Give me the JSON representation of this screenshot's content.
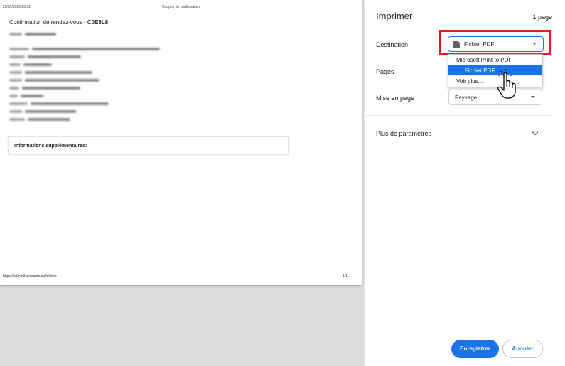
{
  "preview": {
    "header_datetime": "23/01/2026 13:32",
    "header_title": "Coupon de confirmation",
    "doc_title_prefix": "Confirmation de rendez-vous - ",
    "doc_code": "C0E3L8",
    "info_box_title": "Informations supplémentaires:",
    "footer_url": "https://admin3.clicsante.ca/follows",
    "footer_page": "1/1"
  },
  "panel": {
    "title": "Imprimer",
    "page_count": "1 page",
    "destination_label": "Destination",
    "destination_value": "Fichier PDF",
    "pages_label": "Pages",
    "layout_label": "Mise en page",
    "layout_value": "Paysage",
    "more_settings_label": "Plus de paramètres",
    "dropdown_options": [
      "Microsoft Print to PDF",
      "Fichier PDF",
      "Voir plus..."
    ],
    "save_label": "Enregistrer",
    "cancel_label": "Annuler"
  },
  "colors": {
    "accent": "#1a73e8",
    "highlight_frame": "#e51b24"
  },
  "icons": {
    "file": "file-icon",
    "cursor": "hand-cursor-icon"
  }
}
